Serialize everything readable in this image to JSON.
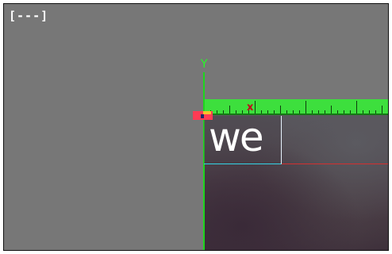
{
  "viewport": {
    "corner_label": "[---]"
  },
  "axes": {
    "y_label": "Y",
    "x_label": "x"
  },
  "layer": {
    "text": "we"
  },
  "colors": {
    "background": "#777777",
    "axis_green": "#1dd61d",
    "ruler_green": "#3ddf3d",
    "x_marker_red": "#c4001a",
    "guide_red": "#d23030",
    "selection_cyan": "#33d3e6",
    "origin_handle_pink": "#ff3b54",
    "origin_handle_yellow": "#f7c02b"
  },
  "icons": [
    "origin-handle-icon"
  ]
}
